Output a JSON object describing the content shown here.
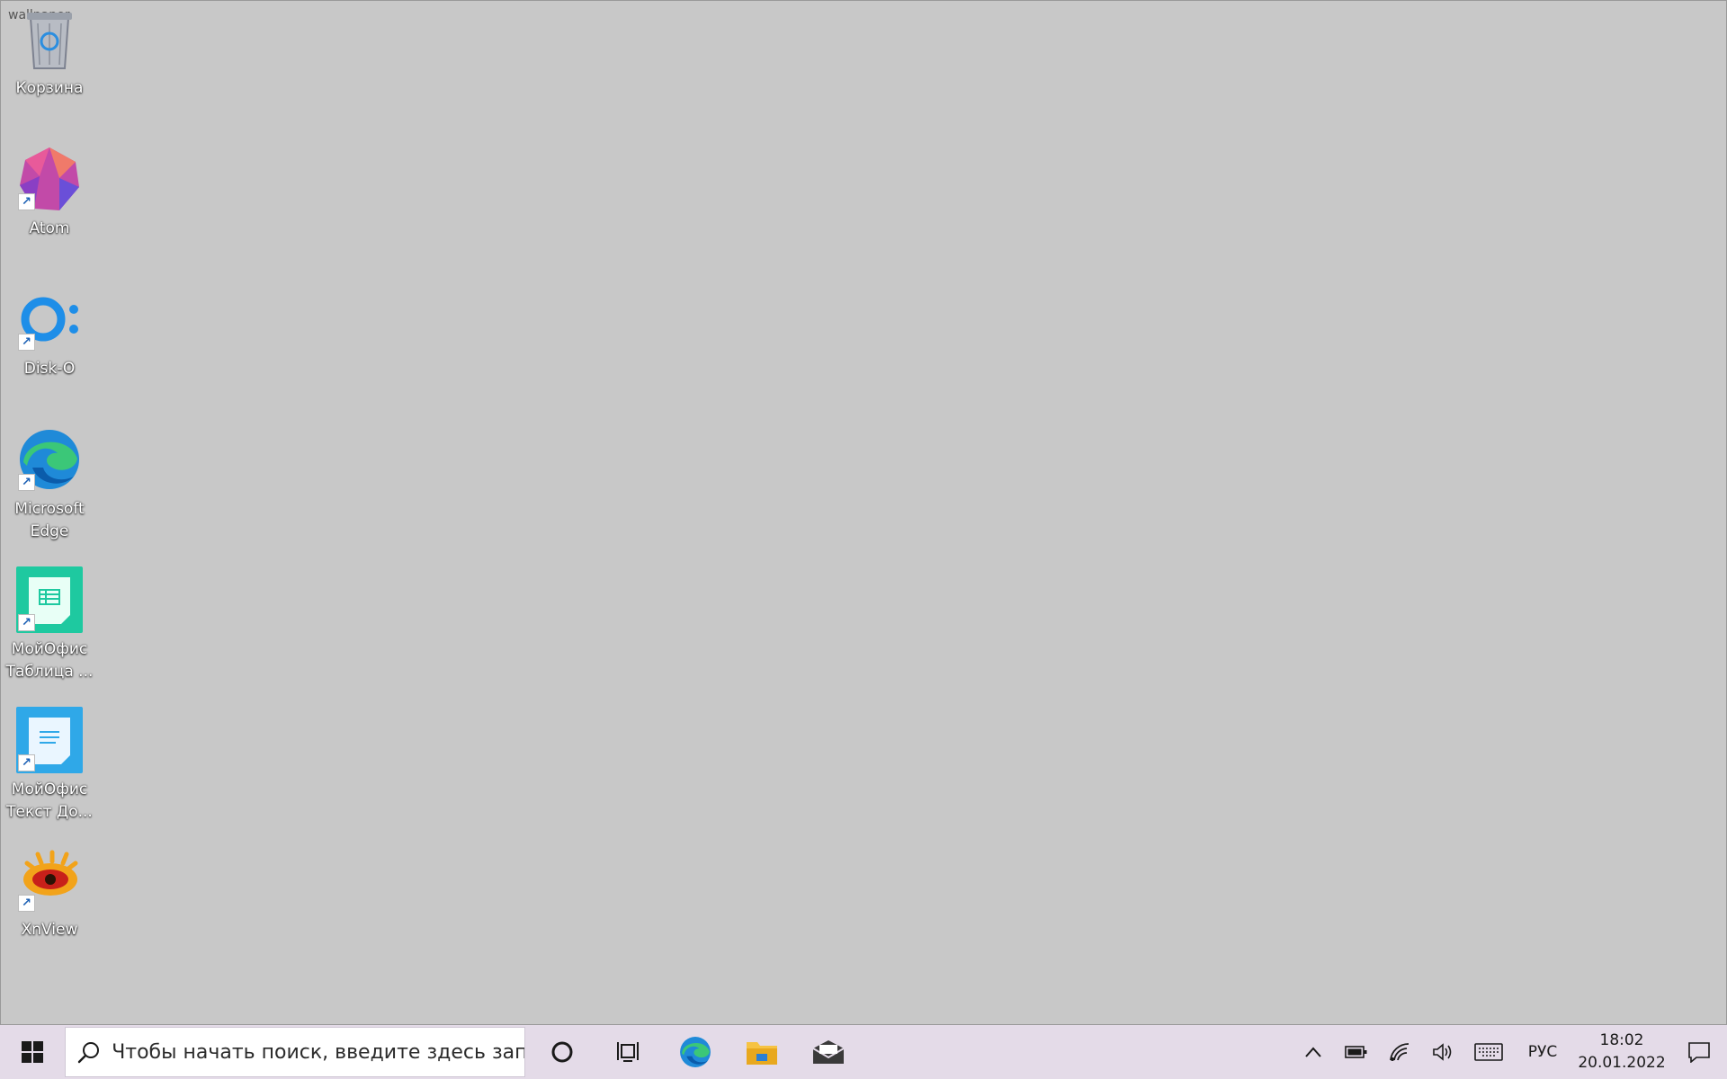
{
  "wallpaper": {
    "label": "wallpaper"
  },
  "desktop": {
    "icons": [
      {
        "name": "recycle-bin",
        "label": "Корзина"
      },
      {
        "name": "atom",
        "label": "Atom"
      },
      {
        "name": "disk-o",
        "label": "Disk-O"
      },
      {
        "name": "microsoft-edge",
        "label": "Microsoft Edge"
      },
      {
        "name": "myoffice-table",
        "label": "МойОфис Таблица ..."
      },
      {
        "name": "myoffice-text",
        "label": "МойОфис Текст До..."
      },
      {
        "name": "xnview",
        "label": "XnView"
      }
    ]
  },
  "taskbar": {
    "search_placeholder": "Чтобы начать поиск, введите здесь запрос",
    "language": "РУС",
    "time": "18:02",
    "date": "20.01.2022",
    "colors": {
      "taskbar_bg": "#e4dbe8",
      "accent": "#0078d4"
    }
  }
}
